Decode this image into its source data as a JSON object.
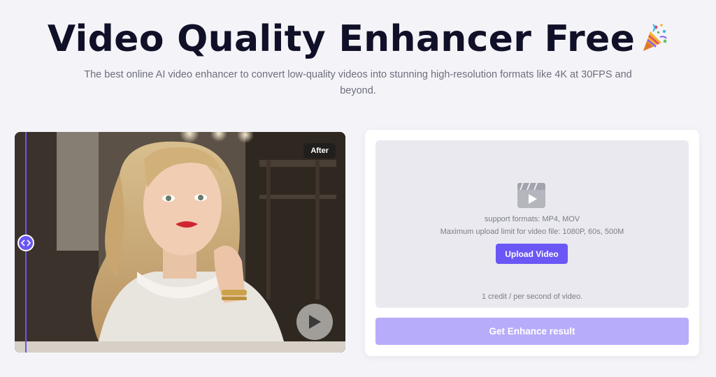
{
  "header": {
    "title": "Video Quality Enhancer Free",
    "subtitle": "The best online AI video enhancer to convert low-quality videos into stunning high-resolution formats like 4K at 30FPS and beyond."
  },
  "preview": {
    "badge": "After",
    "handle_icon": "chevrons-left-right-icon",
    "play_icon": "play-icon"
  },
  "upload": {
    "icon": "video-clapper-icon",
    "formats": "support formats: MP4, MOV",
    "limit": "Maximum upload limit for video file: 1080P, 60s, 500M",
    "button_label": "Upload Video",
    "credit_note": "1 credit / per second of video.",
    "enhance_label": "Get Enhance result"
  },
  "colors": {
    "accent": "#6a57f5",
    "accent_disabled": "#b7acf9",
    "background": "#f4f4f8"
  }
}
